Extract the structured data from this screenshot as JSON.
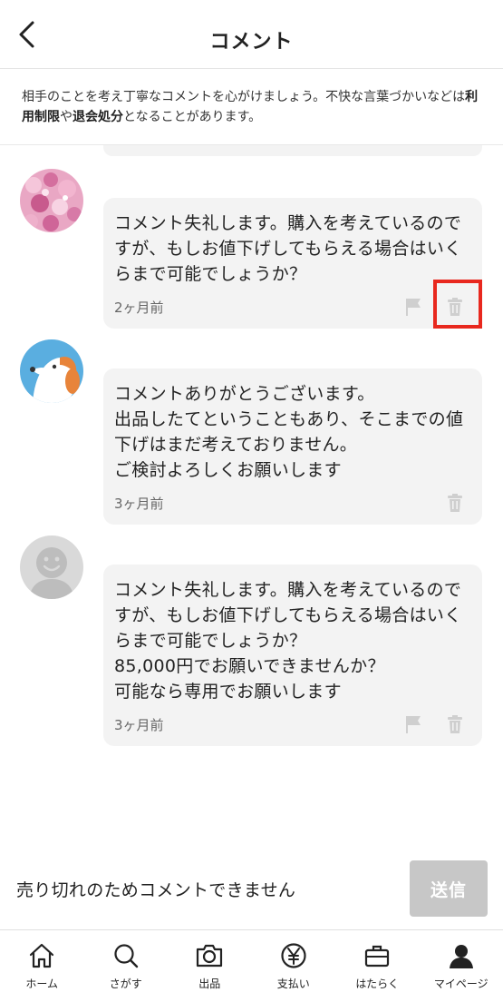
{
  "header": {
    "title": "コメント"
  },
  "notice": {
    "text_1": "相手のことを考え丁寧なコメントを心がけましょう。不快な言葉づかいなどは",
    "bold_1": "利用制限",
    "text_2": "や",
    "bold_2": "退会処分",
    "text_3": "となることがあります。"
  },
  "comments": [
    {
      "avatar": "cherry-blossom-avatar",
      "text": "コメント失礼します。購入を考えているのですが、もしお値下げしてもらえる場合はいくらまで可能でしょうか？",
      "time": "2ヶ月前",
      "show_flag": true
    },
    {
      "avatar": "dog-avatar",
      "text": "コメントありがとうございます。\n出品したてということもあり、そこまでの値下げはまだ考えておりません。\nご検討よろしくお願いします",
      "time": "3ヶ月前",
      "show_flag": false
    },
    {
      "avatar": "default-user-avatar",
      "text": "コメント失礼します。購入を考えているのですが、もしお値下げしてもらえる場合はいくらまで可能でしょうか？\n85,000円でお願いできませんか？\n可能なら専用でお願いします",
      "time": "3ヶ月前",
      "show_flag": true
    }
  ],
  "footer": {
    "closed_message": "売り切れのためコメントできません",
    "send_label": "送信"
  },
  "tabs": [
    {
      "label": "ホーム",
      "icon": "home-icon"
    },
    {
      "label": "さがす",
      "icon": "search-icon"
    },
    {
      "label": "出品",
      "icon": "camera-icon"
    },
    {
      "label": "支払い",
      "icon": "yen-icon"
    },
    {
      "label": "はたらく",
      "icon": "briefcase-icon"
    },
    {
      "label": "マイページ",
      "icon": "person-icon"
    }
  ],
  "colors": {
    "highlight": "#e8281e",
    "bubble": "#f3f3f3",
    "send_disabled": "#c7c7c7"
  }
}
